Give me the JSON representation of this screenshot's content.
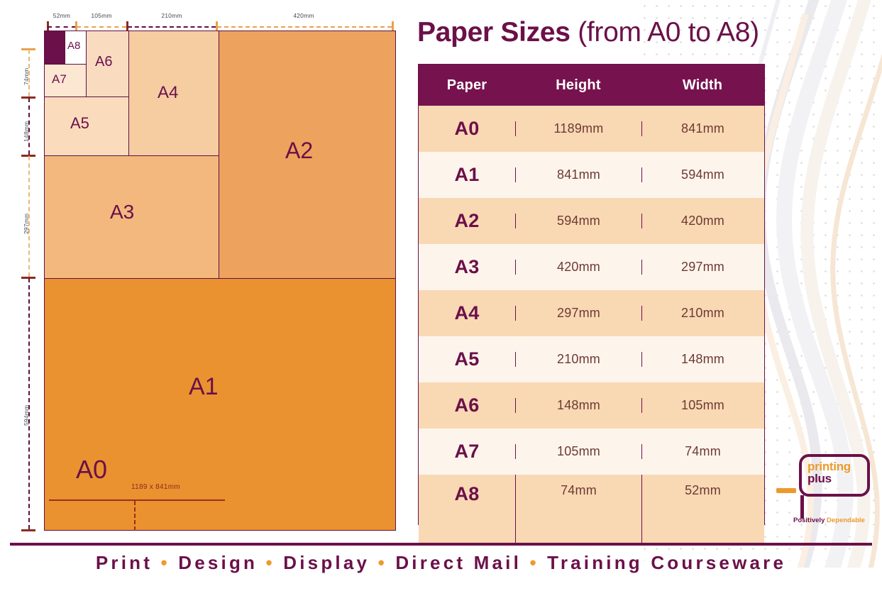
{
  "title": {
    "bold": "Paper Sizes",
    "light": "(from A0 to A8)"
  },
  "table": {
    "headers": [
      "Paper",
      "Height",
      "Width"
    ],
    "rows": [
      {
        "paper": "A0",
        "height": "1189mm",
        "width": "841mm"
      },
      {
        "paper": "A1",
        "height": "841mm",
        "width": "594mm"
      },
      {
        "paper": "A2",
        "height": "594mm",
        "width": "420mm"
      },
      {
        "paper": "A3",
        "height": "420mm",
        "width": "297mm"
      },
      {
        "paper": "A4",
        "height": "297mm",
        "width": "210mm"
      },
      {
        "paper": "A5",
        "height": "210mm",
        "width": "148mm"
      },
      {
        "paper": "A6",
        "height": "148mm",
        "width": "105mm"
      },
      {
        "paper": "A7",
        "height": "105mm",
        "width": "74mm"
      },
      {
        "paper": "A8",
        "height": "74mm",
        "width": "52mm"
      }
    ]
  },
  "diagram": {
    "boxes": [
      {
        "label": "A1",
        "color": "#ea9230"
      },
      {
        "label": "A2",
        "color": "#eda25d"
      },
      {
        "label": "A3",
        "color": "#f2b87d"
      },
      {
        "label": "A4",
        "color": "#f6ccA1"
      },
      {
        "label": "A5",
        "color": "#fadcbd"
      },
      {
        "label": "A6",
        "color": "#f9dcc0"
      },
      {
        "label": "A7",
        "color": "#fbe7d2"
      },
      {
        "label": "A8",
        "color": "#ffffff"
      },
      {
        "label": "",
        "color": "#6b1049"
      }
    ],
    "a0_label": "A0",
    "a0_caption": "1189 x 841mm",
    "top_dims": [
      "52mm",
      "105mm",
      "210mm",
      "420mm"
    ],
    "side_dims": [
      "74mm",
      "148mm",
      "297mm",
      "594mm"
    ]
  },
  "logo": {
    "line1": "printing",
    "line2": "plus",
    "tag_bold": "Positively",
    "tag_light": "Dependable"
  },
  "footer": {
    "items": [
      "Print",
      "Design",
      "Display",
      "Direct Mail",
      "Training Courseware"
    ],
    "separator": "•"
  },
  "colors": {
    "purple": "#6b1049",
    "orange": "#ec9a2c",
    "header_purple": "#76134f",
    "row_peach": "#f9d8b4",
    "row_cream": "#fdf5ec"
  }
}
